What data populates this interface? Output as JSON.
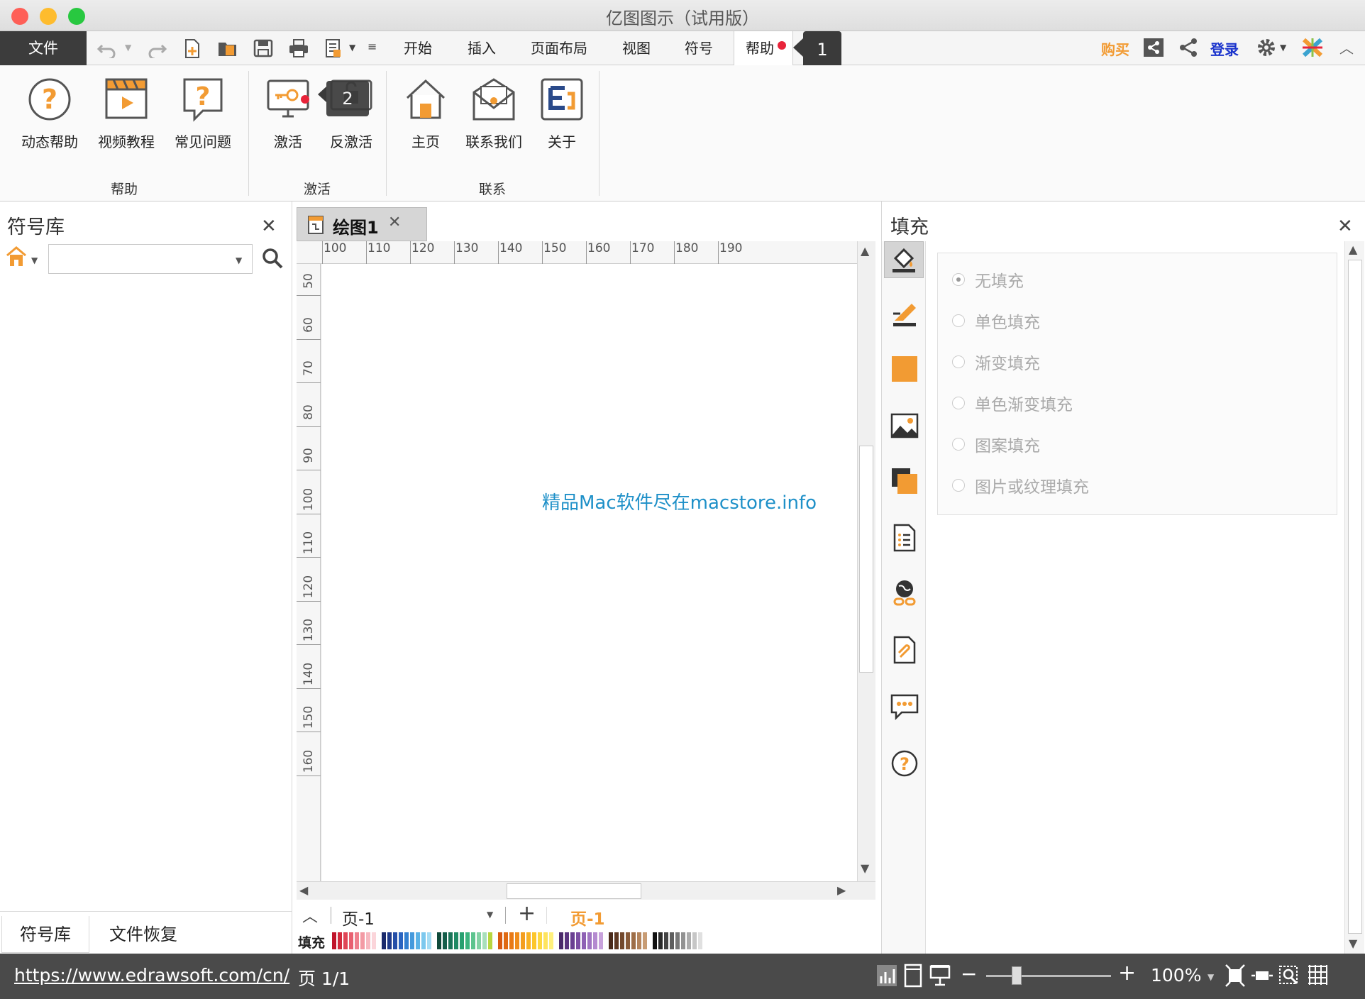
{
  "window": {
    "title": "亿图图示（试用版）",
    "traffic_colors": [
      "#fe5f57",
      "#febc2e",
      "#28c840"
    ]
  },
  "menubar": {
    "file_label": "文件",
    "tabs": [
      "开始",
      "插入",
      "页面布局",
      "视图",
      "符号",
      "帮助"
    ],
    "callout_1": "1",
    "buy_label": "购买",
    "login_label": "登录"
  },
  "ribbon": {
    "groups": {
      "help": {
        "label": "帮助",
        "buttons": [
          "动态帮助",
          "视频教程",
          "常见问题"
        ]
      },
      "activate": {
        "label": "激活",
        "buttons": [
          "激活",
          "反激活"
        ],
        "callout_2": "2"
      },
      "contact": {
        "label": "联系",
        "buttons": [
          "主页",
          "联系我们",
          "关于"
        ]
      }
    }
  },
  "left_panel": {
    "title": "符号库",
    "search_placeholder": "",
    "tabs": [
      "符号库",
      "文件恢复"
    ]
  },
  "document": {
    "tab_label": "绘图1",
    "ruler_top": [
      "100",
      "110",
      "120",
      "130",
      "140",
      "150",
      "160",
      "170",
      "180",
      "190"
    ],
    "ruler_left": [
      "50",
      "60",
      "70",
      "80",
      "90",
      "100",
      "110",
      "120",
      "130",
      "140",
      "150",
      "160"
    ],
    "watermark": "精品Mac软件尽在macstore.info"
  },
  "pages": {
    "page_select": "页-1",
    "active_page": "页-1",
    "palette_label": "填充"
  },
  "right_panel": {
    "title": "填充",
    "options": [
      "无填充",
      "单色填充",
      "渐变填充",
      "单色渐变填充",
      "图案填充",
      "图片或纹理填充"
    ],
    "selected_option": "无填充"
  },
  "status": {
    "url": "https://www.edrawsoft.com/cn/",
    "page": "页 1/1",
    "zoom": "100%"
  },
  "colors": {
    "accent_orange": "#f29b33",
    "login_blue": "#1a33cc",
    "watermark_blue": "#1e90c8",
    "notification_red": "#e8243a"
  }
}
